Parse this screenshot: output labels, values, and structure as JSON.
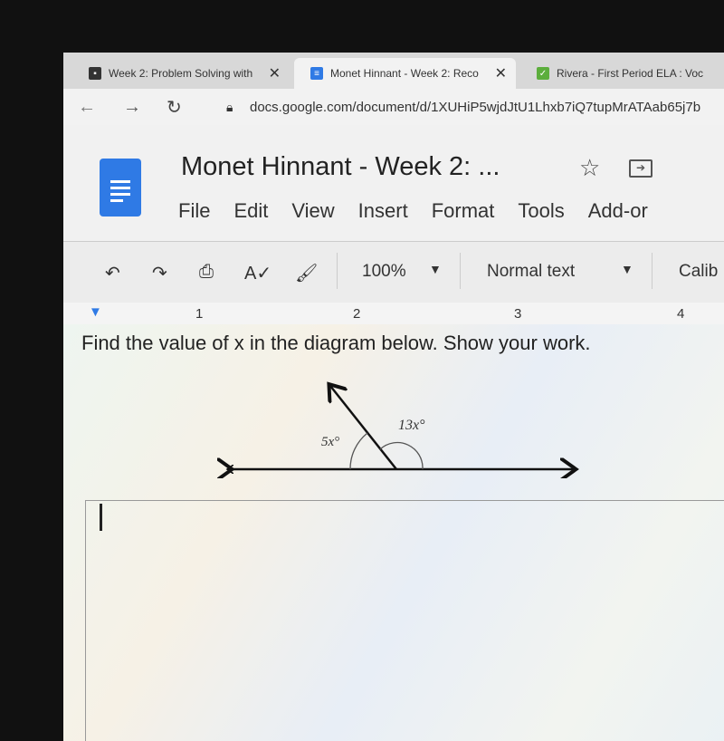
{
  "browser": {
    "tabs": [
      {
        "title": "Week 2: Problem Solving with",
        "icon": "classroom-icon",
        "active": false
      },
      {
        "title": "Monet Hinnant - Week 2: Reco",
        "icon": "docs-icon",
        "active": true
      },
      {
        "title": "Rivera - First Period ELA : Voc",
        "icon": "check-icon",
        "active": false
      }
    ],
    "url": "docs.google.com/document/d/1XUHiP5wjdJtU1Lhxb7iQ7tupMrATAab65j7b"
  },
  "doc": {
    "title": "Monet Hinnant - Week 2: ...",
    "menu": [
      "File",
      "Edit",
      "View",
      "Insert",
      "Format",
      "Tools",
      "Add-or"
    ],
    "toolbar": {
      "zoom": "100%",
      "style": "Normal text",
      "font": "Calib"
    },
    "ruler": [
      "1",
      "2",
      "3",
      "4"
    ],
    "question": "Find the value of x in the diagram below. Show your work.",
    "diagram": {
      "angle_left": "5x°",
      "angle_right": "13x°"
    }
  },
  "colors": {
    "docs_blue": "#2f7ae5",
    "text": "#222222"
  }
}
